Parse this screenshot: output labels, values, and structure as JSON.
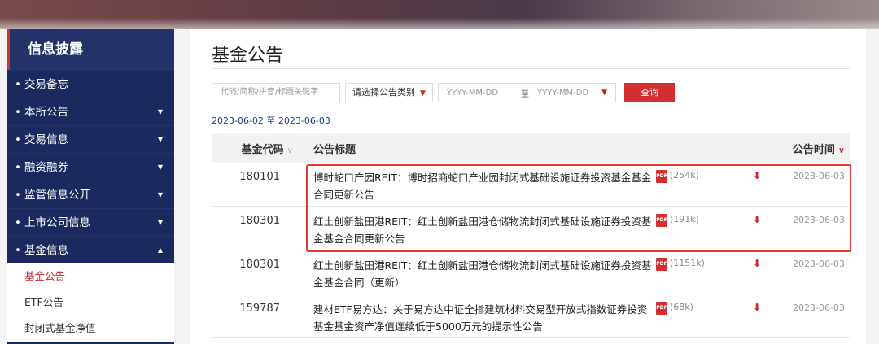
{
  "sidebar": {
    "title": "信息披露",
    "items": [
      {
        "label": "交易备忘",
        "caret": ""
      },
      {
        "label": "本所公告",
        "caret": "▼"
      },
      {
        "label": "交易信息",
        "caret": "▼"
      },
      {
        "label": "融资融券",
        "caret": "▼"
      },
      {
        "label": "监管信息公开",
        "caret": "▼"
      },
      {
        "label": "上市公司信息",
        "caret": "▼"
      },
      {
        "label": "基金信息",
        "caret": "▲"
      }
    ],
    "sub_items": [
      {
        "label": "基金公告",
        "active": true
      },
      {
        "label": "ETF公告",
        "active": false
      },
      {
        "label": "封闭式基金净值",
        "active": false
      }
    ]
  },
  "main": {
    "page_title": "基金公告",
    "filters": {
      "keyword_placeholder": "代码/简称/拼音/标题关键字",
      "category_label": "请选择公告类别",
      "date_from_placeholder": "YYYY-MM-DD",
      "date_sep": "至",
      "date_to_placeholder": "YYYY-MM-DD",
      "query_label": "查询"
    },
    "range_text": "2023-06-02 至 2023-06-03",
    "table": {
      "headers": {
        "code": "基金代码",
        "title": "公告标题",
        "time": "公告时间"
      },
      "rows": [
        {
          "code": "180101",
          "title": "博时蛇口产园REIT：博时招商蛇口产业园封闭式基础设施证券投资基金基金合同更新公告",
          "size": "(254k)",
          "date": "2023-06-03"
        },
        {
          "code": "180301",
          "title": "红土创新盐田港REIT：红土创新盐田港仓储物流封闭式基础设施证券投资基金基金合同更新公告",
          "size": "(191k)",
          "date": "2023-06-03"
        },
        {
          "code": "180301",
          "title": "红土创新盐田港REIT：红土创新盐田港仓储物流封闭式基础设施证券投资基金基金合同（更新）",
          "size": "(1151k)",
          "date": "2023-06-03"
        },
        {
          "code": "159787",
          "title": "建材ETF易方达：关于易方达中证全指建筑材料交易型开放式指数证券投资基金基金资产净值连续低于5000万元的提示性公告",
          "size": "(68k)",
          "date": "2023-06-03"
        }
      ]
    }
  },
  "colors": {
    "accent": "#d32f2f",
    "sidebar_bg": "#1a2a5e",
    "link_blue": "#1a3a8a"
  }
}
